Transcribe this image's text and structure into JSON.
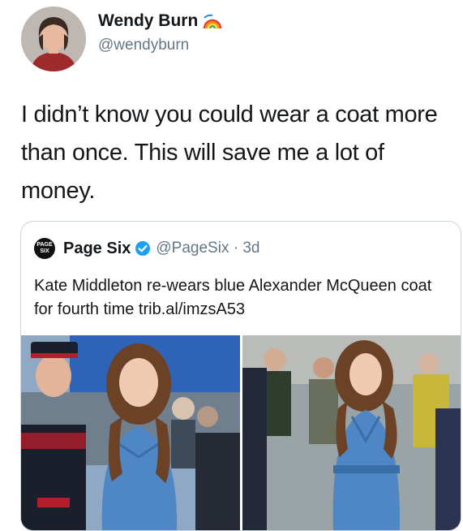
{
  "author": {
    "name": "Wendy Burn",
    "handle": "@wendyburn",
    "badge_icon": "rainbow-icon"
  },
  "tweet": {
    "text": "I didn’t know you could wear a coat more than once. This will save me a lot of money."
  },
  "quoted": {
    "logo_text": "PAGE SIX",
    "name": "Page Six",
    "verified_icon": "verified-badge-icon",
    "handle_time": "@PageSix · 3d",
    "text": "Kate Middleton re-wears blue Alexander McQueen coat for fourth time trib.al/imzsA53"
  },
  "colors": {
    "text": "#14171a",
    "secondary": "#657786",
    "border": "#ccd6dd",
    "verified": "#1da1f2",
    "coat_blue": "#4f86c6"
  }
}
